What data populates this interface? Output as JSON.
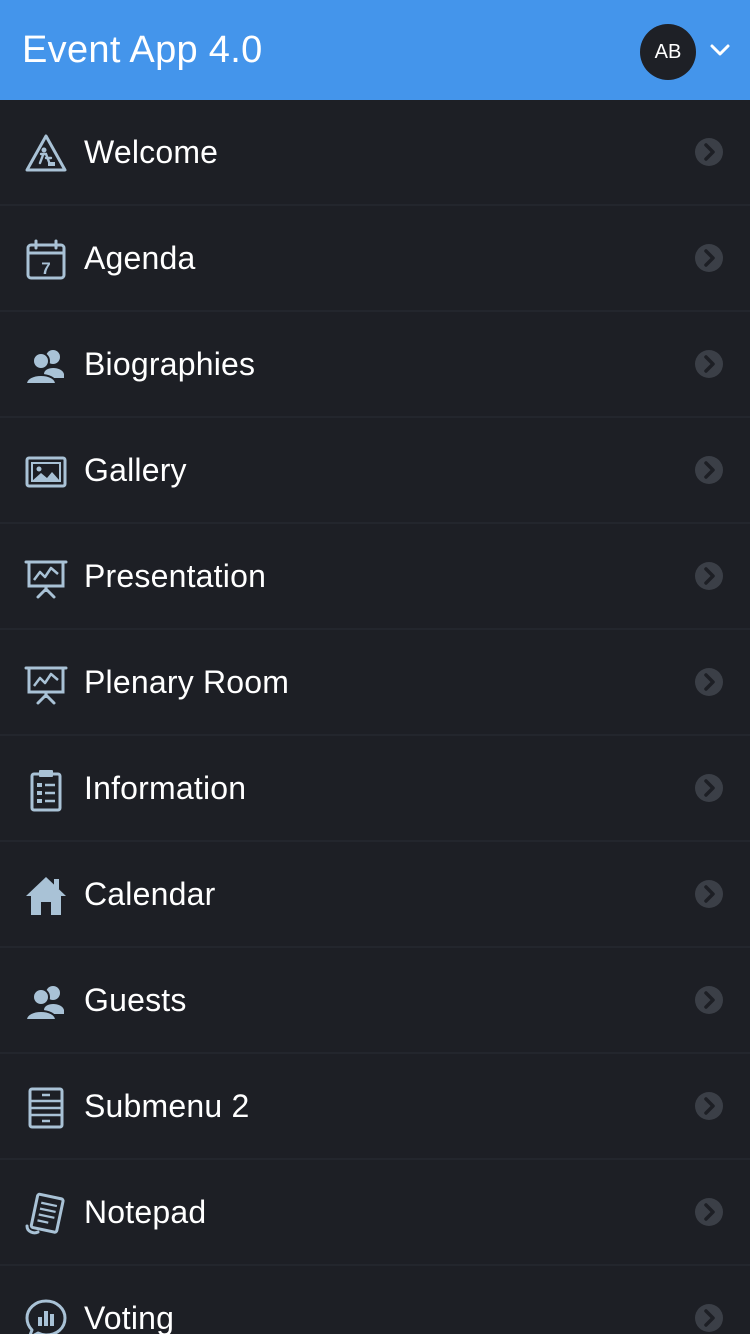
{
  "header": {
    "title": "Event App 4.0",
    "avatar_initials": "AB",
    "dropdown_icon": "chevron-down-icon",
    "background_color": "#4495eb"
  },
  "menu": {
    "items": [
      {
        "label": "Welcome",
        "icon": "construction-sign-icon"
      },
      {
        "label": "Agenda",
        "icon": "calendar-icon"
      },
      {
        "label": "Biographies",
        "icon": "users-icon"
      },
      {
        "label": "Gallery",
        "icon": "image-icon"
      },
      {
        "label": "Presentation",
        "icon": "presentation-board-icon"
      },
      {
        "label": "Plenary Room",
        "icon": "presentation-board-icon"
      },
      {
        "label": "Information",
        "icon": "clipboard-icon"
      },
      {
        "label": "Calendar",
        "icon": "home-icon"
      },
      {
        "label": "Guests",
        "icon": "users-icon"
      },
      {
        "label": "Submenu 2",
        "icon": "cabinet-icon"
      },
      {
        "label": "Notepad",
        "icon": "notepad-icon"
      },
      {
        "label": "Voting",
        "icon": "chat-chart-icon"
      }
    ],
    "background_color": "#1d1f25",
    "icon_color": "#a9c2d6"
  }
}
